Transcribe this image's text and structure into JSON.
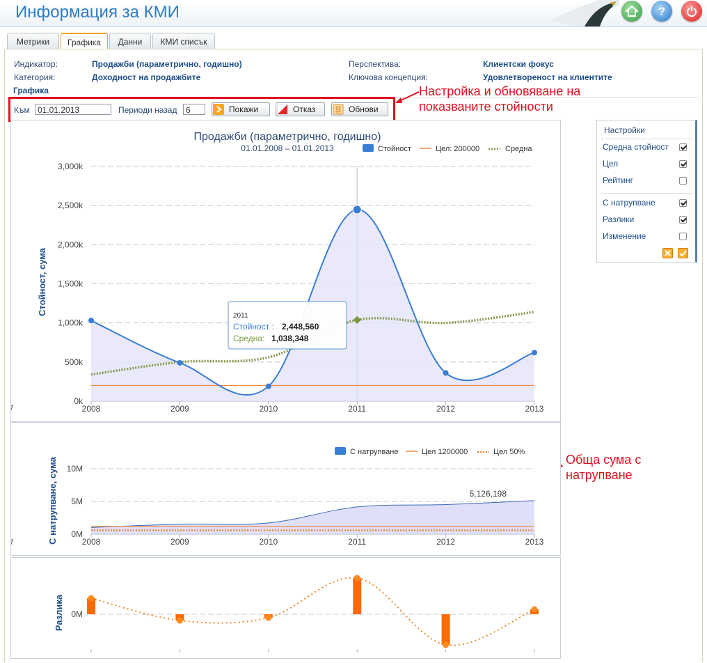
{
  "app": {
    "title": "Информация за КМИ"
  },
  "tabs": [
    {
      "label": "Метрики",
      "active": false
    },
    {
      "label": "Графика",
      "active": true
    },
    {
      "label": "Данни",
      "active": false
    },
    {
      "label": "КМИ списък",
      "active": false
    }
  ],
  "info": {
    "indicator_label": "Индикатор:",
    "indicator_value": "Продажби (параметрично, годишно)",
    "category_label": "Категория:",
    "category_value": "Доходност на продажбите",
    "perspective_label": "Перспектива:",
    "perspective_value": "Клиентски фокус",
    "concept_label": "Ключова концепция:",
    "concept_value": "Удовлетвореност на клиентите",
    "section_title": "Графика"
  },
  "filter": {
    "to_label": "Към",
    "to_value": "01.01.2013",
    "periods_label": "Периоди назад",
    "periods_value": "6",
    "show_button": "Покажи",
    "cancel_button": "Отказ",
    "refresh_button": "Обнови"
  },
  "annotations": {
    "filter_note_line1": "Настройка и обновяване на",
    "filter_note_line2": "показваните стойности",
    "cumulative_note_line1": "Обща сума с",
    "cumulative_note_line2": "натрупване"
  },
  "settings": {
    "title": "Настройки",
    "items": [
      {
        "label": "Средна стойност",
        "checked": true
      },
      {
        "label": "Цел",
        "checked": true
      },
      {
        "label": "Рейтинг",
        "checked": false
      },
      {
        "label": "С натрупване",
        "checked": true
      },
      {
        "label": "Разлики",
        "checked": true
      },
      {
        "label": "Изменение",
        "checked": false
      }
    ]
  },
  "colors": {
    "accent": "#2f7cc4",
    "series_value": "#3a7dd4",
    "series_avg": "#8a9a50",
    "target": "#f08a40",
    "diff": "#ff6a00",
    "annotation": "#e01020"
  },
  "chart_data": [
    {
      "type": "line",
      "title": "Продажби (параметрично, годишно)",
      "subtitle": "01.01.2008 – 01.01.2013",
      "ylabel": "Стойност, сума",
      "x": [
        "2008",
        "2009",
        "2010",
        "2011",
        "2012",
        "2013"
      ],
      "ylim": [
        0,
        3000000
      ],
      "yticks": [
        "0k",
        "500k",
        "1,000k",
        "1,500k",
        "2,000k",
        "2,500k",
        "3,000k"
      ],
      "legend": {
        "value": "Стойност",
        "target": "Цел: 200000",
        "avg": "Средна"
      },
      "series": [
        {
          "name": "Стойност",
          "values": [
            1030000,
            490000,
            190000,
            2448560,
            360000,
            620000
          ]
        },
        {
          "name": "Средна",
          "values": [
            340000,
            500000,
            560000,
            1038348,
            1000000,
            1140000
          ]
        },
        {
          "name": "Цел: 200000",
          "values": [
            200000,
            200000,
            200000,
            200000,
            200000,
            200000
          ]
        }
      ],
      "tooltip": {
        "title": "2011",
        "value_label": "Стойност :",
        "value": "2,448,560",
        "avg_label": "Средна:",
        "avg": "1,038,348"
      },
      "axis_stub": "7"
    },
    {
      "type": "area",
      "ylabel": "С натрупване, сума",
      "x": [
        "2008",
        "2009",
        "2010",
        "2011",
        "2012",
        "2013"
      ],
      "ylim": [
        0,
        10000000
      ],
      "yticks": [
        "0M",
        "5M",
        "10M"
      ],
      "legend": {
        "cumulative": "С натрупване",
        "target": "Цел 1200000",
        "target50": "Цел 50%"
      },
      "series": [
        {
          "name": "С натрупване",
          "values": [
            1030000,
            1520000,
            1710000,
            4160000,
            4520000,
            5126198
          ]
        },
        {
          "name": "Цел 1200000",
          "values": [
            1200000,
            1200000,
            1200000,
            1200000,
            1200000,
            1200000
          ]
        },
        {
          "name": "Цел 50%",
          "values": [
            600000,
            600000,
            600000,
            600000,
            600000,
            600000
          ]
        }
      ],
      "end_label": "5,126,198",
      "axis_stub": "7"
    },
    {
      "type": "bar",
      "ylabel": "Разлика",
      "x": [
        "2008",
        "2009",
        "2010",
        "2011",
        "2012",
        "2013"
      ],
      "yticks": [
        "0M"
      ],
      "values": [
        0.23,
        -0.09,
        -0.05,
        0.52,
        -0.44,
        0.07
      ]
    }
  ]
}
